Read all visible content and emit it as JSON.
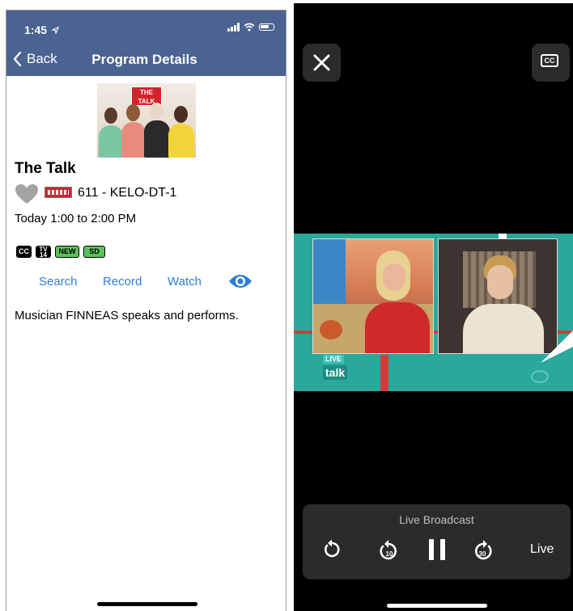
{
  "status_bar": {
    "time": "1:45"
  },
  "nav": {
    "back_label": "Back",
    "title": "Program Details"
  },
  "program": {
    "thumb_logo": "THE TALK",
    "title": "The Talk",
    "channel": "611 - KELO-DT-1",
    "airtime": "Today 1:00 to 2:00 PM",
    "badges": [
      "CC",
      "TV 14",
      "NEW",
      "SD"
    ],
    "description": "Musician FINNEAS speaks and performs."
  },
  "actions": {
    "search": "Search",
    "record": "Record",
    "watch": "Watch"
  },
  "player": {
    "cc_label": "CC",
    "video_live_tag": "LIVE",
    "video_show_tag": "talk",
    "broadcast_label": "Live Broadcast",
    "skip_back": "10",
    "skip_forward": "30",
    "live_label": "Live"
  },
  "colors": {
    "nav_bar": "#4a6390",
    "action_link": "#2f7bd8",
    "badge_green": "#5cc25c",
    "player_bg": "#000000",
    "control_bg": "#2b2b2b"
  },
  "icons": [
    "location-arrow-icon",
    "signal-icon",
    "wifi-icon",
    "battery-icon",
    "chevron-left-icon",
    "heart-icon",
    "eye-icon",
    "close-icon",
    "cc-icon",
    "restart-icon",
    "skip-back-10-icon",
    "pause-icon",
    "skip-forward-30-icon"
  ]
}
